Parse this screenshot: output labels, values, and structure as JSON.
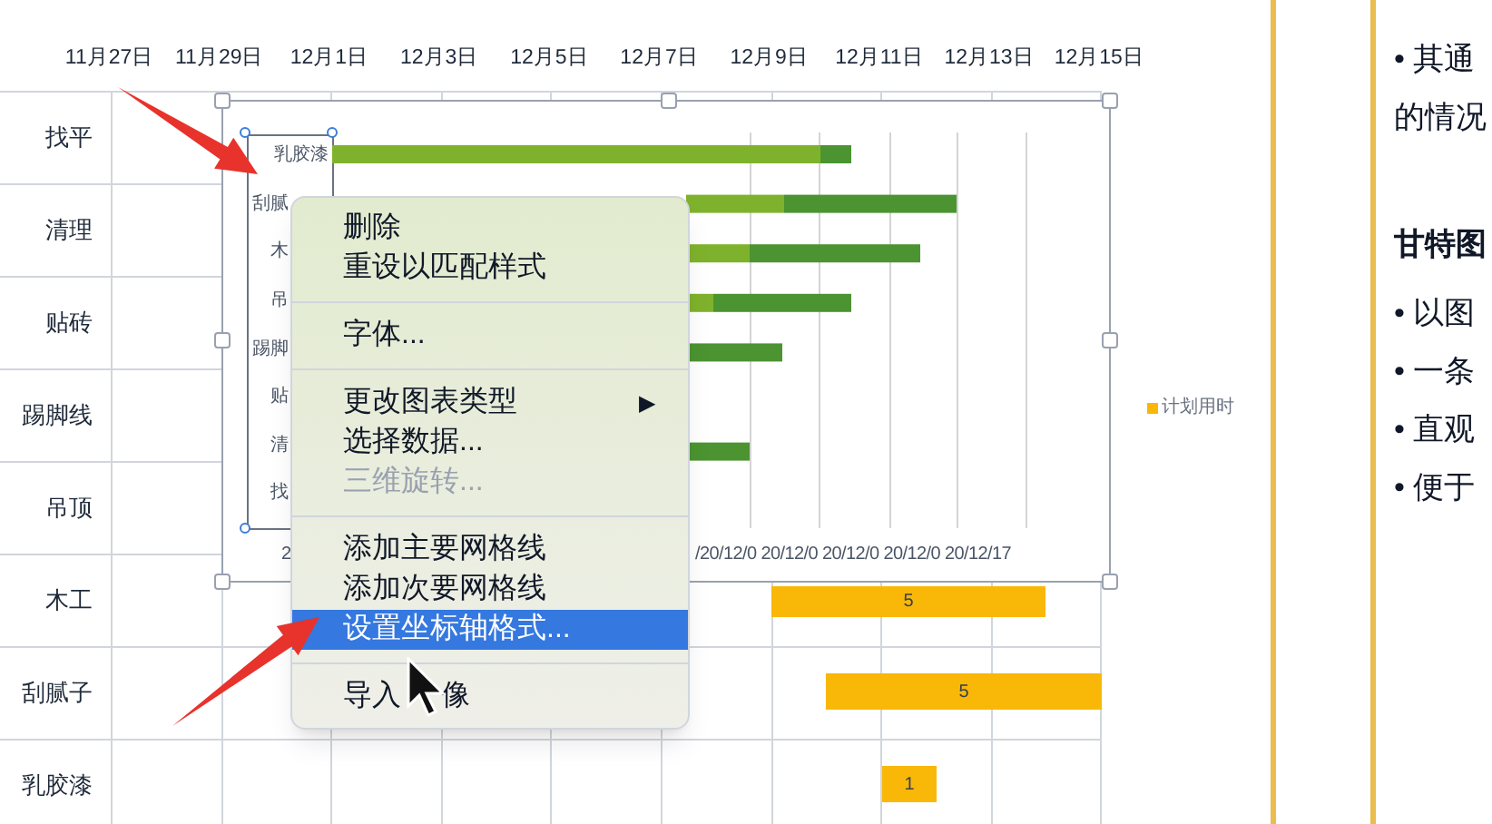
{
  "sheet": {
    "date_headers": [
      "11月27日",
      "11月29日",
      "12月1日",
      "12月3日",
      "12月5日",
      "12月7日",
      "12月9日",
      "12月11日",
      "12月13日",
      "12月15日"
    ],
    "rows": [
      {
        "label": "找平"
      },
      {
        "label": "清理"
      },
      {
        "label": "贴砖"
      },
      {
        "label": "踢脚线"
      },
      {
        "label": "吊顶"
      },
      {
        "label": "木工",
        "bar": "5"
      },
      {
        "label": "刮腻子",
        "bar": "5"
      },
      {
        "label": "乳胶漆",
        "bar": "1"
      }
    ]
  },
  "chart": {
    "categories": [
      "乳胶漆",
      "刮腻",
      "木",
      "吊",
      "踢脚",
      "贴",
      "清",
      "找"
    ],
    "axis_labels": [
      "2",
      "/20/12/0 20/12/0 20/12/0 20/12/0 20/12/17"
    ],
    "legend": "计划用时"
  },
  "context_menu": [
    {
      "kind": "item",
      "label": "删除",
      "disabled": false,
      "selected": false
    },
    {
      "kind": "item",
      "label": "重设以匹配样式",
      "disabled": false,
      "selected": false
    },
    {
      "kind": "separator"
    },
    {
      "kind": "item",
      "label": "字体...",
      "disabled": false,
      "selected": false
    },
    {
      "kind": "separator"
    },
    {
      "kind": "submenu",
      "label": "更改图表类型",
      "arrow": "▶",
      "disabled": false,
      "selected": false
    },
    {
      "kind": "item",
      "label": "选择数据...",
      "disabled": false,
      "selected": false
    },
    {
      "kind": "item",
      "label": "三维旋转...",
      "disabled": true,
      "selected": false
    },
    {
      "kind": "separator"
    },
    {
      "kind": "item",
      "label": "添加主要网格线",
      "disabled": false,
      "selected": false
    },
    {
      "kind": "item",
      "label": "添加次要网格线",
      "disabled": false,
      "selected": false
    },
    {
      "kind": "item",
      "label": "设置坐标轴格式...",
      "disabled": false,
      "selected": true
    },
    {
      "kind": "separator"
    },
    {
      "kind": "item",
      "label": "导入",
      "trailing": "像",
      "disabled": false,
      "selected": false
    }
  ],
  "notes": [
    {
      "kind": "bullet",
      "text": "• 其通"
    },
    {
      "kind": "plain",
      "text": "的情况"
    },
    {
      "kind": "heading",
      "text": "甘特图"
    },
    {
      "kind": "bullet",
      "text": "• 以图"
    },
    {
      "kind": "bullet",
      "text": "• 一条"
    },
    {
      "kind": "bullet",
      "text": "• 直观"
    },
    {
      "kind": "bullet",
      "text": "• 便于"
    }
  ]
}
